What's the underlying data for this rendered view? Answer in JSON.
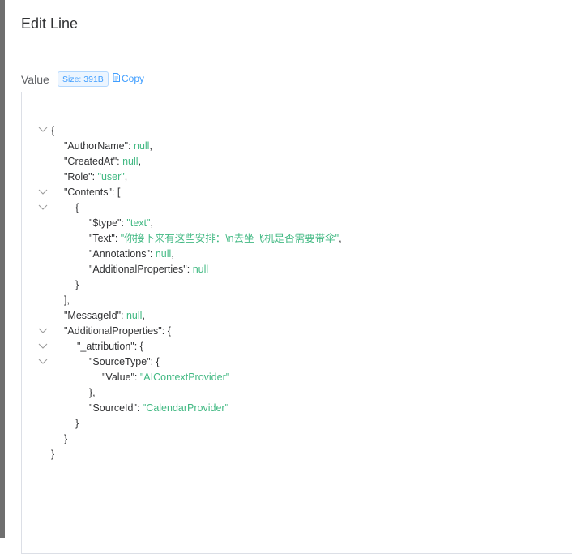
{
  "dialog": {
    "title": "Edit Line"
  },
  "value_field": {
    "label": "Value",
    "size_badge": "Size: 391B",
    "copy_label": "Copy"
  },
  "json": {
    "author_key": "\"AuthorName\"",
    "created_key": "\"CreatedAt\"",
    "role_key": "\"Role\"",
    "role_value": "\"user\"",
    "contents_key": "\"Contents\"",
    "type_key": "\"$type\"",
    "type_value": "\"text\"",
    "text_key": "\"Text\"",
    "text_value": "\"你接下来有这些安排：\\n去坐飞机是否需要带伞\"",
    "annotations_key": "\"Annotations\"",
    "addprops_key": "\"AdditionalProperties\"",
    "message_key": "\"MessageId\"",
    "attribution_key": "\"_attribution\"",
    "source_type_key": "\"SourceType\"",
    "value_key": "\"Value\"",
    "value_value": "\"AIContextProvider\"",
    "source_id_key": "\"SourceId\"",
    "source_id_value": "\"CalendarProvider\"",
    "null_literal": "null"
  }
}
